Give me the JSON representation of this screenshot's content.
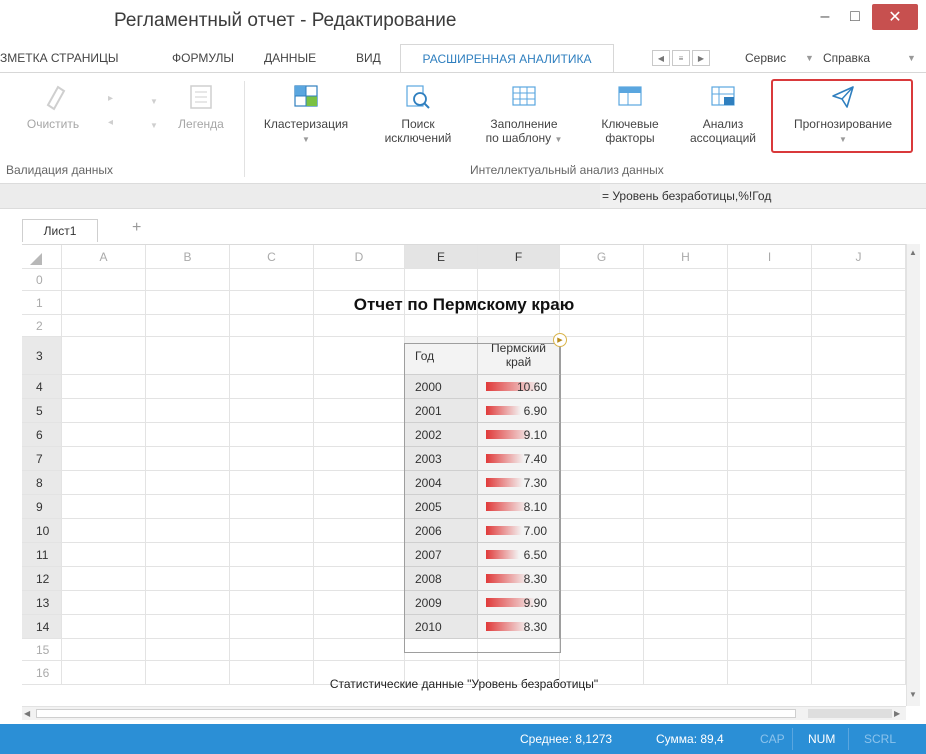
{
  "window": {
    "title": "Регламентный отчет - Редактирование",
    "min": "–",
    "max": "□",
    "close": "✕"
  },
  "tabs": {
    "items": [
      "ЗМЕТКА СТРАНИЦЫ",
      "ФОРМУЛЫ",
      "ДАННЫЕ",
      "ВИД"
    ],
    "active": "РАСШИРЕННАЯ АНАЛИТИКА",
    "service": "Сервис",
    "help": "Справка"
  },
  "ribbon": {
    "clear": "Очистить",
    "legend": "Легенда",
    "clustering": "Кластеризация",
    "exceptions": "Поиск исключений",
    "fill_pattern_line1": "Заполнение",
    "fill_pattern_line2": "по шаблону",
    "key_factors_line1": "Ключевые",
    "key_factors_line2": "факторы",
    "associations_line1": "Анализ",
    "associations_line2": "ассоциаций",
    "forecasting": "Прогнозирование",
    "group_validation": "Валидация данных",
    "group_intelligent": "Интеллектуальный анализ данных"
  },
  "formula_bar": {
    "text": "= Уровень безработицы,%!Год"
  },
  "sheets": {
    "tab": "Лист1",
    "add": "+"
  },
  "grid": {
    "columns": [
      "A",
      "B",
      "C",
      "D",
      "E",
      "F",
      "G",
      "H",
      "I",
      "J"
    ],
    "row_numbers": [
      "0",
      "1",
      "2",
      "3",
      "4",
      "5",
      "6",
      "7",
      "8",
      "9",
      "10",
      "11",
      "12",
      "13",
      "14",
      "15",
      "16"
    ]
  },
  "report": {
    "title": "Отчет по Пермскому краю",
    "header_year": "Год",
    "header_region_line1": "Пермский",
    "header_region_line2": "край",
    "footnote": "Статистические данные \"Уровень безработицы\"",
    "rows": [
      {
        "year": "2000",
        "value": "10.60",
        "num": 10.6
      },
      {
        "year": "2001",
        "value": "6.90",
        "num": 6.9
      },
      {
        "year": "2002",
        "value": "9.10",
        "num": 9.1
      },
      {
        "year": "2003",
        "value": "7.40",
        "num": 7.4
      },
      {
        "year": "2004",
        "value": "7.30",
        "num": 7.3
      },
      {
        "year": "2005",
        "value": "8.10",
        "num": 8.1
      },
      {
        "year": "2006",
        "value": "7.00",
        "num": 7.0
      },
      {
        "year": "2007",
        "value": "6.50",
        "num": 6.5
      },
      {
        "year": "2008",
        "value": "8.30",
        "num": 8.3
      },
      {
        "year": "2009",
        "value": "9.90",
        "num": 9.9
      },
      {
        "year": "2010",
        "value": "8.30",
        "num": 8.3
      }
    ]
  },
  "status": {
    "average": "Среднее: 8,1273",
    "sum": "Сумма: 89,4",
    "cap": "CAP",
    "num": "NUM",
    "scrl": "SCRL"
  },
  "colors": {
    "accent": "#2f7fbf",
    "statusbar": "#2b8fd6",
    "highlight": "#d9393b",
    "databar": "#e03a3a"
  }
}
